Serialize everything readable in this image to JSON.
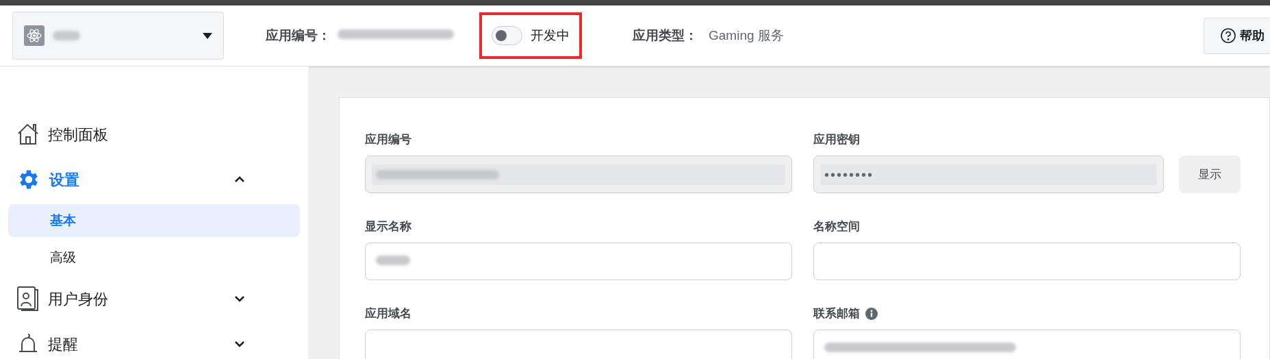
{
  "header": {
    "app_selector": {
      "redacted": true
    },
    "app_id": {
      "label": "应用编号：",
      "redacted": true
    },
    "mode_toggle": {
      "on": false,
      "label": "开发中",
      "highlighted": true
    },
    "app_type": {
      "label": "应用类型：",
      "value": "Gaming 服务"
    },
    "help_button": {
      "label": "帮助"
    }
  },
  "sidebar": {
    "items": [
      {
        "kind": "home",
        "label": "控制面板",
        "selected": false
      },
      {
        "kind": "gear",
        "label": "设置",
        "selected": true,
        "expanded": true,
        "children": [
          {
            "label": "基本",
            "selected": true
          },
          {
            "label": "高级",
            "selected": false
          }
        ]
      },
      {
        "kind": "badge",
        "label": "用户身份",
        "selected": false,
        "expanded": false
      },
      {
        "kind": "bell",
        "label": "提醒",
        "selected": false,
        "expanded": false
      }
    ]
  },
  "form": {
    "fields": [
      {
        "label": "应用编号",
        "disabled": true,
        "redacted": true
      },
      {
        "label": "应用密钥",
        "disabled": true,
        "value": "••••••••",
        "button": "显示"
      },
      {
        "label": "显示名称",
        "disabled": false,
        "redacted": true
      },
      {
        "label": "名称空间",
        "disabled": false
      },
      {
        "label": "应用域名",
        "disabled": false
      },
      {
        "label": "联系邮箱",
        "disabled": false,
        "info": true,
        "redacted": true
      }
    ]
  }
}
